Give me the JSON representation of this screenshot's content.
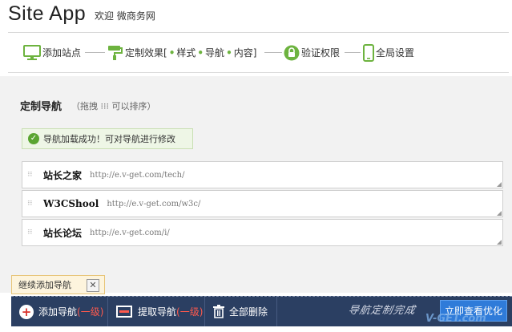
{
  "header": {
    "app_title": "Site App",
    "welcome": "欢迎 微商务网"
  },
  "steps": {
    "add_site": "添加站点",
    "custom_effect_prefix": "定制效果[",
    "custom_effect_style": "样式",
    "custom_effect_nav": "导航",
    "custom_effect_content": "内容]",
    "verify": "验证权限",
    "global": "全局设置",
    "active_color": "#6db33f"
  },
  "section": {
    "title": "定制导航",
    "hint": "（拖拽 ⁝⁝⁝ 可以排序）"
  },
  "notice": {
    "text": "导航加载成功！可对导航进行修改"
  },
  "nav_items": [
    {
      "name": "站长之家",
      "url": "http://e.v-get.com/tech/"
    },
    {
      "name": "W3CShool",
      "url": "http://e.v-get.com/w3c/"
    },
    {
      "name": "站长论坛",
      "url": "http://e.v-get.com/i/"
    }
  ],
  "continue_add": {
    "label": "继续添加导航",
    "close": "✕"
  },
  "toolbar": {
    "add_nav": "添加导航",
    "add_nav_level": "(一级)",
    "extract_nav": "提取导航",
    "extract_nav_level": "(一级)",
    "delete_all": "全部删除",
    "done_note": "导航定制完成",
    "view_button": "立即查看优化",
    "toolbar_color": "#2b3f62"
  },
  "watermark": "V-GET.com"
}
